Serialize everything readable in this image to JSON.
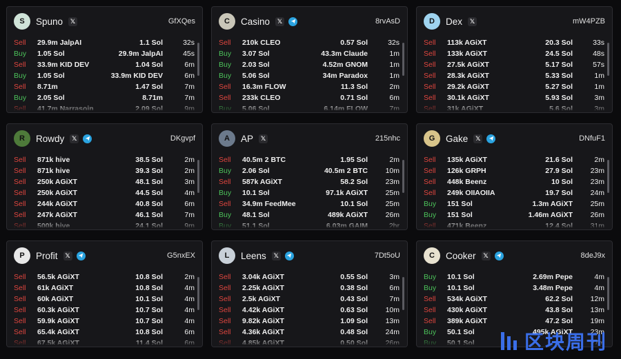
{
  "cards": [
    {
      "name": "Spuno",
      "code": "GfXQes",
      "avatar": "S",
      "avatar_color": "#cfe3d8",
      "telegram": false,
      "rows": [
        [
          "Sell",
          "29.9m JalpAI",
          "1.1 Sol",
          "32s"
        ],
        [
          "Buy",
          "1.05 Sol",
          "29.9m JalpAI",
          "45s"
        ],
        [
          "Sell",
          "33.9m KID DEV",
          "1.04 Sol",
          "6m"
        ],
        [
          "Buy",
          "1.05 Sol",
          "33.9m KID DEV",
          "6m"
        ],
        [
          "Sell",
          "8.71m",
          "1.47 Sol",
          "7m"
        ],
        [
          "Buy",
          "2.05 Sol",
          "8.71m",
          "7m"
        ],
        [
          "Sell",
          "41.7m Narrasoin",
          "2.09 Sol",
          "9m"
        ]
      ]
    },
    {
      "name": "Casino",
      "code": "8rvAsD",
      "avatar": "C",
      "avatar_color": "#c9c6b8",
      "telegram": true,
      "rows": [
        [
          "Sell",
          "210k CLEO",
          "0.57 Sol",
          "32s"
        ],
        [
          "Buy",
          "3.07 Sol",
          "43.3m Claude",
          "1m"
        ],
        [
          "Buy",
          "2.03 Sol",
          "4.52m GNOM",
          "1m"
        ],
        [
          "Buy",
          "5.06 Sol",
          "34m Paradox",
          "1m"
        ],
        [
          "Sell",
          "16.3m FLOW",
          "11.3 Sol",
          "2m"
        ],
        [
          "Sell",
          "233k CLEO",
          "0.71 Sol",
          "6m"
        ],
        [
          "Buy",
          "5.06 Sol",
          "6.14m FLOW",
          "7m"
        ]
      ]
    },
    {
      "name": "Dex",
      "code": "mW4PZB",
      "avatar": "D",
      "avatar_color": "#9fd4f0",
      "telegram": false,
      "rows": [
        [
          "Sell",
          "113k AGiXT",
          "20.3 Sol",
          "33s"
        ],
        [
          "Sell",
          "133k AGiXT",
          "24.5 Sol",
          "48s"
        ],
        [
          "Sell",
          "27.5k AGiXT",
          "5.17 Sol",
          "57s"
        ],
        [
          "Sell",
          "28.3k AGiXT",
          "5.33 Sol",
          "1m"
        ],
        [
          "Sell",
          "29.2k AGiXT",
          "5.27 Sol",
          "1m"
        ],
        [
          "Sell",
          "30.1k AGiXT",
          "5.93 Sol",
          "3m"
        ],
        [
          "Sell",
          "31k AGiXT",
          "5.6 Sol",
          "3m"
        ]
      ]
    },
    {
      "name": "Rowdy",
      "code": "DKgvpf",
      "avatar": "R",
      "avatar_color": "#4e7a3a",
      "telegram": true,
      "rows": [
        [
          "Sell",
          "871k hive",
          "38.5 Sol",
          "2m"
        ],
        [
          "Sell",
          "871k hive",
          "39.3 Sol",
          "2m"
        ],
        [
          "Sell",
          "250k AGiXT",
          "48.1 Sol",
          "3m"
        ],
        [
          "Sell",
          "250k AGiXT",
          "44.5 Sol",
          "4m"
        ],
        [
          "Sell",
          "244k AGiXT",
          "40.8 Sol",
          "6m"
        ],
        [
          "Sell",
          "247k AGiXT",
          "46.1 Sol",
          "7m"
        ],
        [
          "Sell",
          "500k hive",
          "24.1 Sol",
          "9m"
        ]
      ]
    },
    {
      "name": "AP",
      "code": "215nhc",
      "avatar": "A",
      "avatar_color": "#6c7a8c",
      "telegram": false,
      "rows": [
        [
          "Sell",
          "40.5m 2 BTC",
          "1.95 Sol",
          "2m"
        ],
        [
          "Buy",
          "2.06 Sol",
          "40.5m 2 BTC",
          "10m"
        ],
        [
          "Sell",
          "587k AGiXT",
          "58.2 Sol",
          "23m"
        ],
        [
          "Buy",
          "10.1 Sol",
          "97.1k AGiXT",
          "25m"
        ],
        [
          "Sell",
          "34.9m FeedMee",
          "10.1 Sol",
          "25m"
        ],
        [
          "Buy",
          "48.1 Sol",
          "489k AGiXT",
          "26m"
        ],
        [
          "Buy",
          "51.1 Sol",
          "6.03m GAIM",
          "2hr"
        ]
      ]
    },
    {
      "name": "Gake",
      "code": "DNfuF1",
      "avatar": "G",
      "avatar_color": "#d8c48a",
      "telegram": true,
      "rows": [
        [
          "Sell",
          "135k AGiXT",
          "21.6 Sol",
          "2m"
        ],
        [
          "Sell",
          "126k GRPH",
          "27.9 Sol",
          "23m"
        ],
        [
          "Sell",
          "448k Beenz",
          "10 Sol",
          "23m"
        ],
        [
          "Sell",
          "249k OIIAOIIA",
          "19.7 Sol",
          "24m"
        ],
        [
          "Buy",
          "151 Sol",
          "1.3m AGiXT",
          "25m"
        ],
        [
          "Buy",
          "151 Sol",
          "1.46m AGiXT",
          "26m"
        ],
        [
          "Sell",
          "471k Beenz",
          "12.4 Sol",
          "31m"
        ]
      ]
    },
    {
      "name": "Profit",
      "code": "G5nxEX",
      "avatar": "P",
      "avatar_color": "#e8e8e8",
      "telegram": true,
      "rows": [
        [
          "Sell",
          "56.5k AGiXT",
          "10.8 Sol",
          "2m"
        ],
        [
          "Sell",
          "61k AGiXT",
          "10.8 Sol",
          "4m"
        ],
        [
          "Sell",
          "60k AGiXT",
          "10.1 Sol",
          "4m"
        ],
        [
          "Sell",
          "60.3k AGiXT",
          "10.7 Sol",
          "4m"
        ],
        [
          "Sell",
          "59.9k AGiXT",
          "10.7 Sol",
          "4m"
        ],
        [
          "Sell",
          "65.4k AGiXT",
          "10.8 Sol",
          "6m"
        ],
        [
          "Sell",
          "67.5k AGiXT",
          "11.4 Sol",
          "6m"
        ]
      ]
    },
    {
      "name": "Leens",
      "code": "7Dt5oU",
      "avatar": "L",
      "avatar_color": "#c8d0d8",
      "telegram": true,
      "rows": [
        [
          "Sell",
          "3.04k AGiXT",
          "0.55 Sol",
          "3m"
        ],
        [
          "Sell",
          "2.25k AGiXT",
          "0.38 Sol",
          "6m"
        ],
        [
          "Sell",
          "2.5k AGiXT",
          "0.43 Sol",
          "7m"
        ],
        [
          "Sell",
          "4.42k AGiXT",
          "0.63 Sol",
          "10m"
        ],
        [
          "Sell",
          "9.82k AGiXT",
          "1.09 Sol",
          "13m"
        ],
        [
          "Sell",
          "4.36k AGiXT",
          "0.48 Sol",
          "24m"
        ],
        [
          "Sell",
          "4.85k AGiXT",
          "0.50 Sol",
          "26m"
        ]
      ]
    },
    {
      "name": "Cooker",
      "code": "8deJ9x",
      "avatar": "C",
      "avatar_color": "#e8e2d0",
      "telegram": true,
      "rows": [
        [
          "Buy",
          "10.1 Sol",
          "2.69m Pepe",
          "4m"
        ],
        [
          "Buy",
          "10.1 Sol",
          "3.48m Pepe",
          "4m"
        ],
        [
          "Sell",
          "534k AGiXT",
          "62.2 Sol",
          "12m"
        ],
        [
          "Sell",
          "430k AGiXT",
          "43.8 Sol",
          "13m"
        ],
        [
          "Sell",
          "389k AGiXT",
          "47.2 Sol",
          "19m"
        ],
        [
          "Buy",
          "50.1 Sol",
          "495k AGiXT",
          "23m"
        ],
        [
          "Buy",
          "50.1 Sol",
          "",
          "27m"
        ]
      ]
    }
  ],
  "colors": {
    "sell": "#e0463f",
    "buy": "#4cc25a",
    "telegram": "#2aa3e0",
    "watermark": "#3a6ee8"
  },
  "icons": {
    "x": "x-logo-icon",
    "telegram": "telegram-icon"
  },
  "watermark": {
    "text": "区块周刊"
  }
}
